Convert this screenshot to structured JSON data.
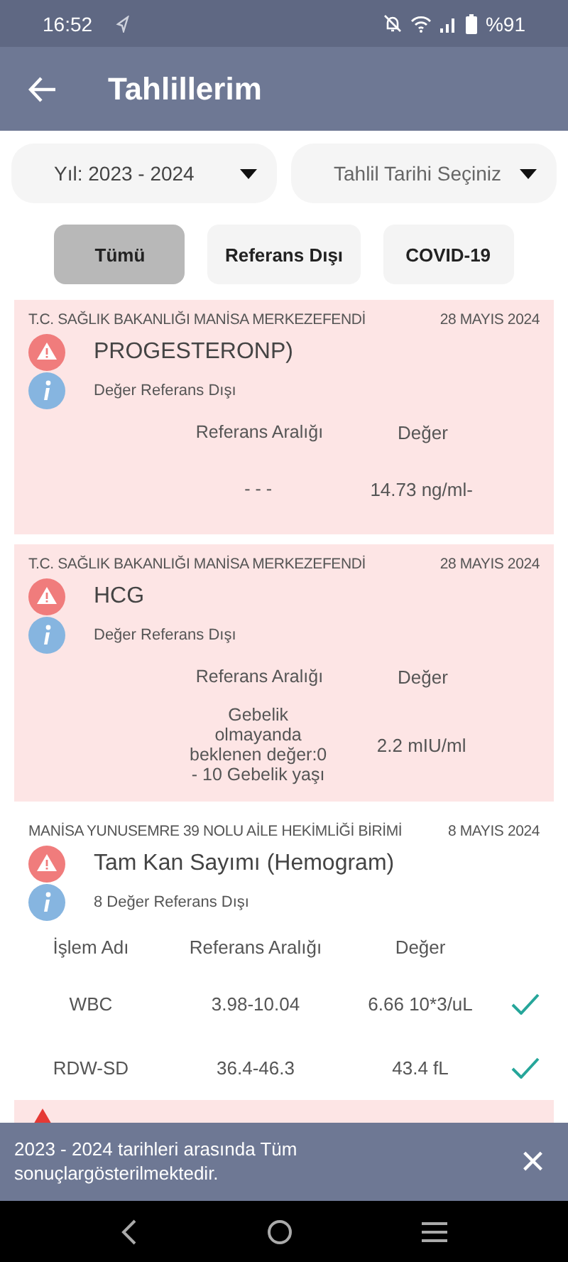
{
  "status_bar": {
    "time": "16:52",
    "battery": "%91"
  },
  "app_bar": {
    "title": "Tahlillerim"
  },
  "filters": [
    {
      "value": "Yıl: 2023 - 2024"
    },
    {
      "placeholder": "Tahlil Tarihi Seçiniz"
    }
  ],
  "tabs": [
    {
      "label": "Tümü",
      "selected": true
    },
    {
      "label": "Referans Dışı",
      "selected": false
    },
    {
      "label": "COVID-19",
      "selected": false
    }
  ],
  "results": [
    {
      "institution": "T.C. SAĞLIK BAKANLIĞI MANİSA MERKEZEFENDİ",
      "date": "28 MAYIS 2024",
      "test": "PROGESTERONP)",
      "note": "Değer Referans Dışı",
      "out_of_range": true,
      "columns": [
        "Referans Aralığı",
        "Değer"
      ],
      "rows": [
        {
          "cells": [
            "- - -",
            "14.73 ng/ml-"
          ]
        }
      ]
    },
    {
      "institution": "T.C. SAĞLIK BAKANLIĞI MANİSA MERKEZEFENDİ",
      "date": "28 MAYIS 2024",
      "test": "HCG",
      "note": "Değer Referans Dışı",
      "out_of_range": true,
      "columns": [
        "Referans Aralığı",
        "Değer"
      ],
      "rows": [
        {
          "cells": [
            "Gebelik olmayanda beklenen değer:0 - 10 Gebelik yaşı",
            "2.2 mIU/ml"
          ]
        }
      ]
    },
    {
      "institution": "MANİSA YUNUSEMRE 39 NOLU AİLE HEKİMLİĞİ BİRİMİ",
      "date": "8 MAYIS 2024",
      "test": "Tam Kan Sayımı (Hemogram)",
      "note": "8 Değer Referans Dışı",
      "out_of_range": false,
      "columns": [
        "İşlem Adı",
        "Referans Aralığı",
        "Değer"
      ],
      "rows": [
        {
          "cells": [
            "WBC",
            "3.98-10.04",
            "6.66 10*3/uL"
          ],
          "out_of_range": false
        },
        {
          "cells": [
            "RDW-SD",
            "36.4-46.3",
            "43.4 fL"
          ],
          "out_of_range": false
        },
        {
          "cells": [],
          "out_of_range": true
        }
      ]
    }
  ],
  "snackbar": {
    "message": "2023 - 2024 tarihleri arasında Tüm sonuçlargösterilmektedir.",
    "close": "×"
  }
}
